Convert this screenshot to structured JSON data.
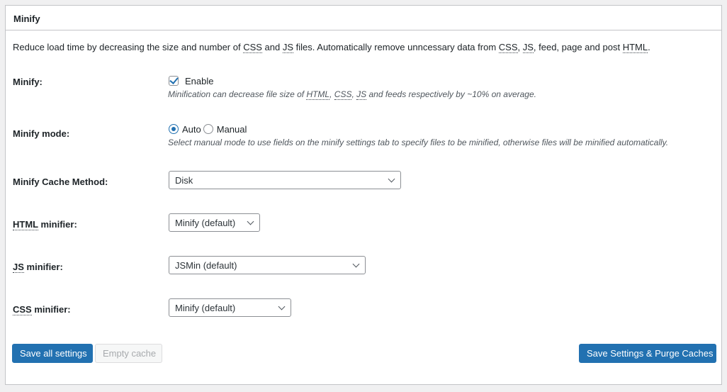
{
  "panel": {
    "title": "Minify"
  },
  "intro": {
    "p1": "Reduce load time by decreasing the size and number of ",
    "abbr_css": "CSS",
    "p2": " and ",
    "abbr_js": "JS",
    "p3": " files. Automatically remove unncessary data from ",
    "abbr_css2": "CSS",
    "p4": ", ",
    "abbr_js2": "JS",
    "p5": ", feed, page and post ",
    "abbr_html": "HTML",
    "p6": "."
  },
  "minify": {
    "label": "Minify:",
    "enable_label": "Enable",
    "enabled": true,
    "desc_p1": "Minification can decrease file size of ",
    "desc_abbr_html": "HTML",
    "desc_p2": ", ",
    "desc_abbr_css": "CSS",
    "desc_p3": ", ",
    "desc_abbr_js": "JS",
    "desc_p4": " and feeds respectively by ~10% on average."
  },
  "minify_mode": {
    "label": "Minify mode:",
    "options": [
      "Auto",
      "Manual"
    ],
    "selected": "Auto",
    "desc": "Select manual mode to use fields on the minify settings tab to specify files to be minified, otherwise files will be minified automatically."
  },
  "cache_method": {
    "label": "Minify Cache Method:",
    "value": "Disk"
  },
  "html_minifier": {
    "label_abbr": "HTML",
    "label_rest": " minifier:",
    "value": "Minify (default)"
  },
  "js_minifier": {
    "label_abbr": "JS",
    "label_rest": " minifier:",
    "value": "JSMin (default)"
  },
  "css_minifier": {
    "label_abbr": "CSS",
    "label_rest": " minifier:",
    "value": "Minify (default)"
  },
  "buttons": {
    "save_all": "Save all settings",
    "empty_cache": "Empty cache",
    "save_purge": "Save Settings & Purge Caches"
  },
  "colors": {
    "primary": "#2271b1",
    "border": "#c3c4c7",
    "background": "#f0f0f1"
  }
}
